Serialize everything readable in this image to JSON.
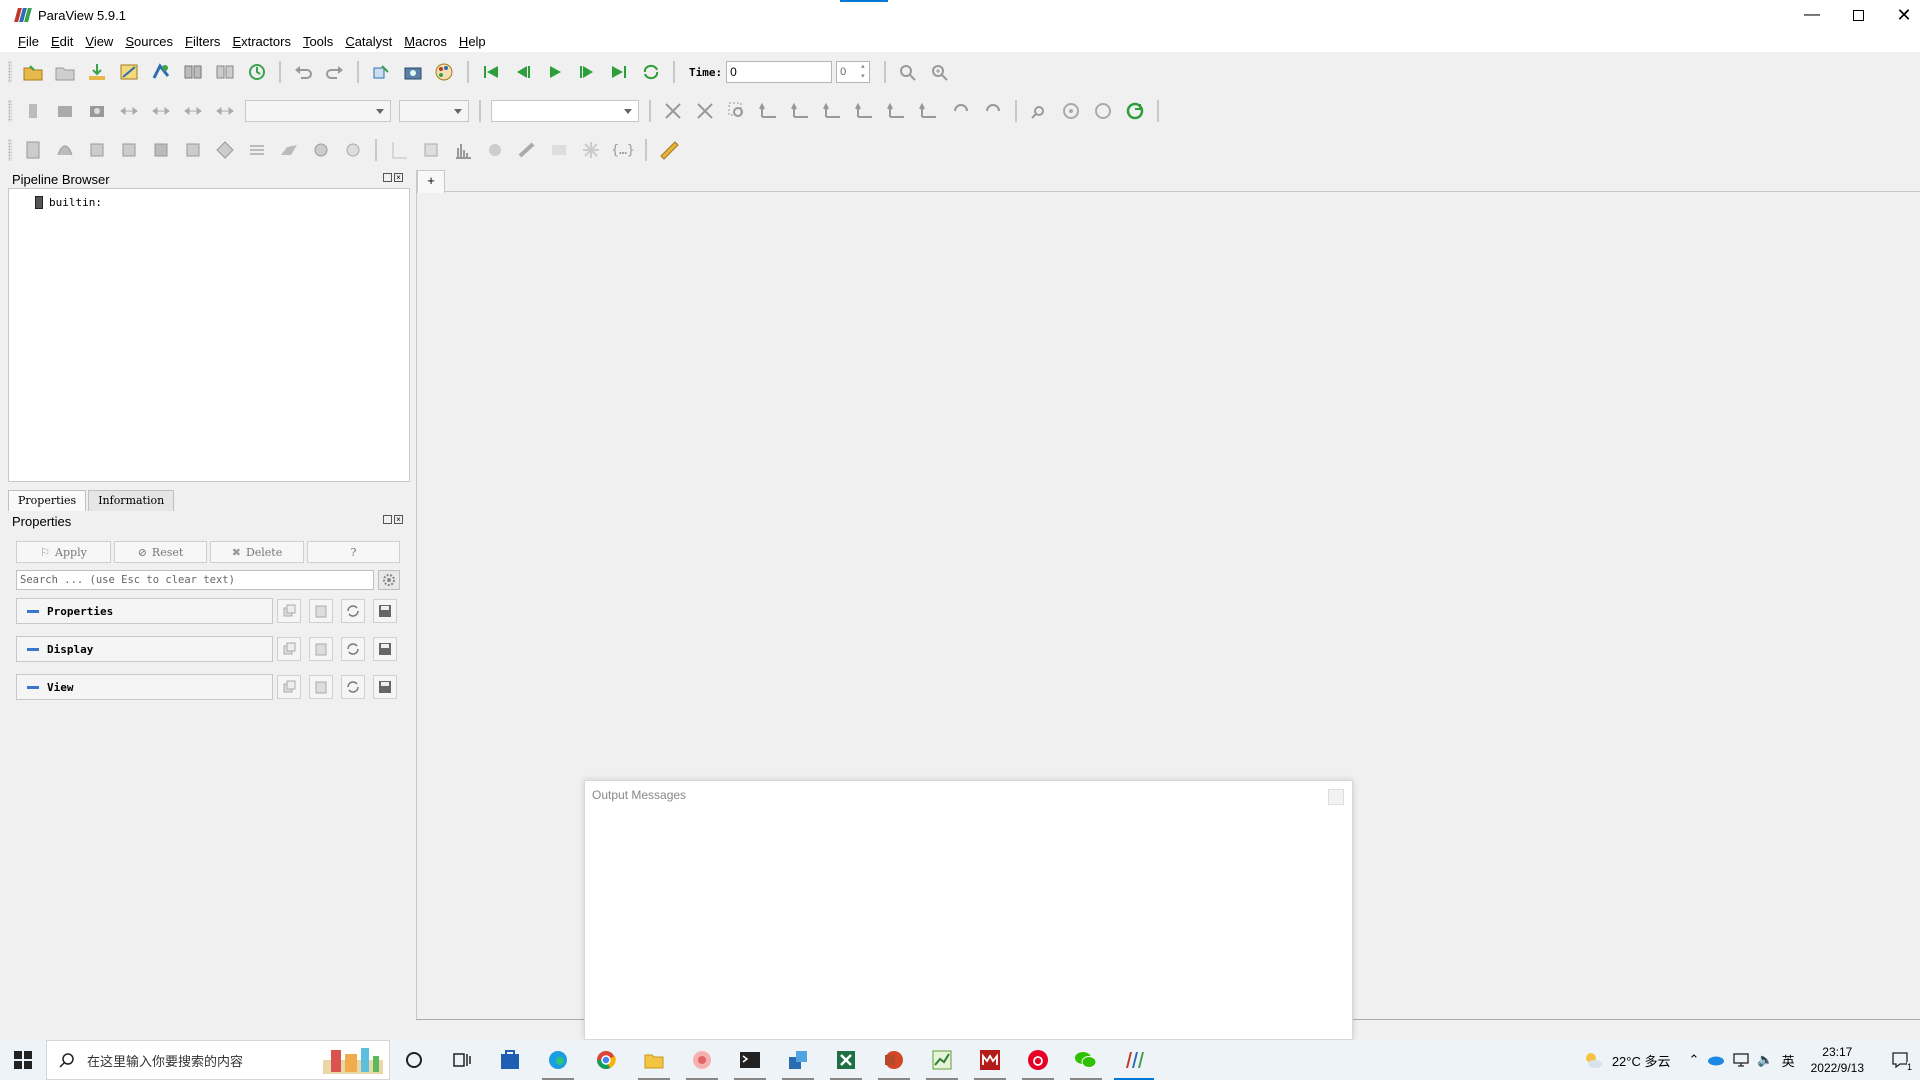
{
  "window": {
    "title": "ParaView 5.9.1"
  },
  "menu": [
    {
      "label": "File",
      "key": "F",
      "rest": "ile"
    },
    {
      "label": "Edit",
      "key": "E",
      "rest": "dit"
    },
    {
      "label": "View",
      "key": "V",
      "rest": "iew"
    },
    {
      "label": "Sources",
      "key": "S",
      "rest": "ources"
    },
    {
      "label": "Filters",
      "key": "F",
      "rest": "ilters"
    },
    {
      "label": "Extractors",
      "key": "E",
      "rest": "xtractors"
    },
    {
      "label": "Tools",
      "key": "T",
      "rest": "ools"
    },
    {
      "label": "Catalyst",
      "key": "C",
      "rest": "atalyst"
    },
    {
      "label": "Macros",
      "key": "M",
      "rest": "acros"
    },
    {
      "label": "Help",
      "key": "H",
      "rest": "elp"
    }
  ],
  "time_toolbar": {
    "label": "Time:",
    "value": "0",
    "index": "0"
  },
  "pipeline_browser": {
    "title": "Pipeline Browser",
    "server": "builtin:"
  },
  "tabs": {
    "properties": "Properties",
    "information": "Information"
  },
  "properties_panel": {
    "title": "Properties",
    "apply": "Apply",
    "reset": "Reset",
    "delete": "Delete",
    "help": "?",
    "search_placeholder": "Search ... (use Esc to clear text)",
    "sections": [
      "Properties",
      "Display",
      "View"
    ]
  },
  "view": {
    "tab_plus": "+"
  },
  "output_messages": {
    "title": "Output Messages"
  },
  "taskbar": {
    "search_placeholder": "在这里输入你要搜索的内容",
    "weather": "22°C 多云",
    "ime": "英",
    "time": "23:17",
    "date": "2022/9/13",
    "notifications": "1"
  },
  "colors": {
    "logo": [
      "#c0392b",
      "#2e6db4",
      "#3aa24b"
    ],
    "accent": "#0078d7",
    "vcr_green": "#2e9e3a"
  }
}
